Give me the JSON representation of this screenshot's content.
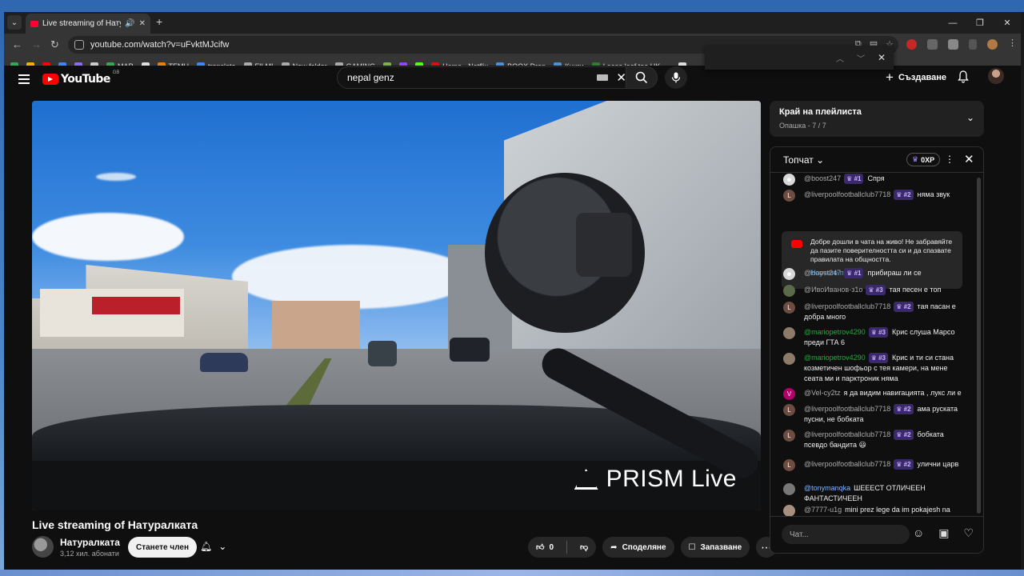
{
  "browser": {
    "tab_title": "Live streaming of Натуралка",
    "new_tab": "+",
    "url": "youtube.com/watch?v=uFvktMJcifw",
    "bookmarks": [
      {
        "label": "",
        "color": "#34a853"
      },
      {
        "label": "",
        "color": "#f9ab00"
      },
      {
        "label": "",
        "color": "#ff0000"
      },
      {
        "label": "",
        "color": "#4285f4"
      },
      {
        "label": "",
        "color": "#8a6cf0"
      },
      {
        "label": "",
        "color": "#cccccc"
      },
      {
        "label": "MAP",
        "color": "#34a853"
      },
      {
        "label": "",
        "color": "#dddddd"
      },
      {
        "label": "TEMU",
        "color": "#f57c00"
      },
      {
        "label": "translate",
        "color": "#4285f4"
      },
      {
        "label": "FILMI",
        "color": "#aaaaaa"
      },
      {
        "label": "New folder",
        "color": "#aaaaaa"
      },
      {
        "label": "GAMING",
        "color": "#aaaaaa"
      },
      {
        "label": "",
        "color": "#7cb342"
      },
      {
        "label": "",
        "color": "#9146ff"
      },
      {
        "label": "",
        "color": "#53fc18"
      },
      {
        "label": "Home - Netflix",
        "color": "#e50914"
      },
      {
        "label": "BOOX Drop",
        "color": "#4a90d9"
      },
      {
        "label": "Книги",
        "color": "#4a90d9"
      },
      {
        "label": "Loose leaf tea UK -...",
        "color": "#2e7d32"
      },
      {
        "label": "",
        "color": "#dddddd"
      }
    ]
  },
  "youtube": {
    "logo_text": "YouTube",
    "logo_region": "GB",
    "search_query": "nepal genz",
    "create_label": "Създаване",
    "video_watermark": "PRISM Live",
    "video_title": "Live streaming of Натуралката",
    "channel_name": "Натуралката",
    "channel_subs": "3,12 хил. абонати",
    "join_label": "Станете член",
    "like_count": "0",
    "share_label": "Споделяне",
    "save_label": "Запазване"
  },
  "playlist": {
    "title": "Край на плейлиста",
    "subtitle": "Опашка - 7 / 7"
  },
  "chat": {
    "header": "Топчат",
    "xp": "0XP",
    "welcome_text": "Добре дошли в чата на живо! Не забравяйте да пазите поверителността си и да спазвате правилата на общността.",
    "welcome_link": "Научете повече",
    "input_placeholder": "Чат...",
    "messages": [
      {
        "author": "@boost247",
        "badge": "#1",
        "text": "Спря",
        "avatar": "☻",
        "avcolor": "#d8d8d8"
      },
      {
        "author": "@liverpoolfootballclub7718",
        "badge": "#2",
        "text": "няма звук",
        "avatar": "L",
        "avcolor": "#6d4c41"
      },
      {
        "author": "@boost247",
        "badge": "#1",
        "text": "прибираш ли се",
        "avatar": "☻",
        "avcolor": "#d8d8d8"
      },
      {
        "author": "@ИвоИванов-з1о",
        "badge": "#3",
        "text": "тая песен е топ",
        "avatar": "",
        "avcolor": "#5b6b4a"
      },
      {
        "author": "@liverpoolfootballclub7718",
        "badge": "#2",
        "text": "тая пасан е добра много",
        "avatar": "L",
        "avcolor": "#6d4c41"
      },
      {
        "author": "@mariopetrov4290",
        "badge": "#3",
        "text": "Крис слуша Марсо преди ГТА 6",
        "avatar": "",
        "avcolor": "#8d7b6a"
      },
      {
        "author": "@mariopetrov4290",
        "badge": "#3",
        "text": "Крис и ти си стана козметичен шофьор с тея камери, на мене сеата ми и парктроник няма",
        "avatar": "",
        "avcolor": "#8d7b6a"
      },
      {
        "author": "@Vel-cy2tz",
        "badge": "",
        "text": "я да видим навигацията , лукс ли е",
        "avatar": "V",
        "avcolor": "#b4006b"
      },
      {
        "author": "@liverpoolfootballclub7718",
        "badge": "#2",
        "text": "ама руската пусни, не бобката",
        "avatar": "L",
        "avcolor": "#6d4c41"
      },
      {
        "author": "@liverpoolfootballclub7718",
        "badge": "#2",
        "text": "бобката псевдо бандита 😃",
        "avatar": "L",
        "avcolor": "#6d4c41"
      },
      {
        "author": "@liverpoolfootballclub7718",
        "badge": "#2",
        "text": "улични царв",
        "avatar": "L",
        "avcolor": "#6d4c41"
      },
      {
        "author": "@tonymanqka",
        "badge": "",
        "text": "ШЕЕЕСТ ОТЛИЧЕЕН ФАНТАСТИЧЕЕН",
        "avatar": "",
        "avcolor": "#777777"
      },
      {
        "author": "@7777-u1g",
        "badge": "",
        "text": "mini prez lege da im pokajesh na guzarite koi e chovekut",
        "avatar": "",
        "avcolor": "#a89080"
      }
    ]
  }
}
